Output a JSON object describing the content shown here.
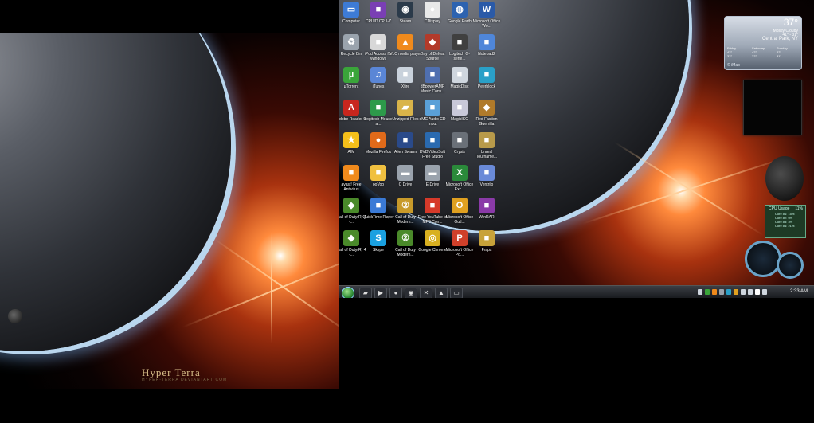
{
  "left_monitor": {
    "title": "Hyper Terra",
    "subtitle": "HYPER-TERRA DEVIANTART COM"
  },
  "desktop_icons": [
    {
      "label": "Computer",
      "icon": "computer-icon",
      "color": "#3d7bd6"
    },
    {
      "label": "CPUID CPU-Z",
      "icon": "cpuz-icon",
      "color": "#7a3fb4"
    },
    {
      "label": "Steam",
      "icon": "steam-icon",
      "color": "#2b3a4a"
    },
    {
      "label": "CDisplay",
      "icon": "speech-bubble-icon",
      "color": "#e9e9e9"
    },
    {
      "label": "Google Earth",
      "icon": "globe-icon",
      "color": "#2d63b0"
    },
    {
      "label": "Microsoft Office Wo...",
      "icon": "word-icon",
      "color": "#2a5aa8"
    },
    {
      "label": "Recycle Bin",
      "icon": "recycle-bin-icon",
      "color": "#9aa3ad"
    },
    {
      "label": "iPod Access for Windows",
      "icon": "ipod-icon",
      "color": "#d8d8d8"
    },
    {
      "label": "VLC media player",
      "icon": "vlc-icon",
      "color": "#f08a1c"
    },
    {
      "label": "Day of Defeat Source",
      "icon": "game-icon",
      "color": "#b33a2a"
    },
    {
      "label": "Logitech G-serie...",
      "icon": "logitech-icon",
      "color": "#404040"
    },
    {
      "label": "Notepad2",
      "icon": "notepad-icon",
      "color": "#4f86d9"
    },
    {
      "label": "µTorrent",
      "icon": "utorrent-icon",
      "color": "#3aa53a"
    },
    {
      "label": "iTunes",
      "icon": "itunes-icon",
      "color": "#5a86d6"
    },
    {
      "label": "Xfire",
      "icon": "xfire-icon",
      "color": "#c9d2dc"
    },
    {
      "label": "dBpowerAMP Music Conv...",
      "icon": "music-converter-icon",
      "color": "#4f6fb0"
    },
    {
      "label": "MagicDisc",
      "icon": "disc-icon",
      "color": "#cfd6de"
    },
    {
      "label": "Peerblock",
      "icon": "peerblock-icon",
      "color": "#2aa0c8"
    },
    {
      "label": "Adobe Reader 9",
      "icon": "adobe-reader-icon",
      "color": "#c8261e"
    },
    {
      "label": "Logitech Mouse a...",
      "icon": "mouse-icon",
      "color": "#2d9a4a"
    },
    {
      "label": "Unzipped Files",
      "icon": "folder-icon",
      "color": "#d9b44a"
    },
    {
      "label": "dMC Audio CD Input",
      "icon": "cd-icon",
      "color": "#5aa0d8"
    },
    {
      "label": "MagicISO",
      "icon": "magiciso-icon",
      "color": "#c8c8d8"
    },
    {
      "label": "Red Faction Guerrilla",
      "icon": "game-icon",
      "color": "#b07a2a"
    },
    {
      "label": "AIM",
      "icon": "aim-icon",
      "color": "#f5c01a"
    },
    {
      "label": "Mozilla Firefox",
      "icon": "firefox-icon",
      "color": "#e06a1a"
    },
    {
      "label": "Alien Swarm",
      "icon": "alien-swarm-icon",
      "color": "#2a4a8a"
    },
    {
      "label": "DVDVideoSoft Free Studio",
      "icon": "dvd-icon",
      "color": "#2a6ab0"
    },
    {
      "label": "Crysis",
      "icon": "crysis-icon",
      "color": "#6a7078"
    },
    {
      "label": "Unreal Tourname...",
      "icon": "unreal-icon",
      "color": "#b89a4a"
    },
    {
      "label": "avast! Free Antivirus",
      "icon": "avast-icon",
      "color": "#f08a1c"
    },
    {
      "label": "ooVoo",
      "icon": "oovoo-icon",
      "color": "#f0c040"
    },
    {
      "label": "C Drive",
      "icon": "drive-icon",
      "color": "#9aa3ad"
    },
    {
      "label": "E Drive",
      "icon": "drive-icon",
      "color": "#9aa3ad"
    },
    {
      "label": "Microsoft Office Exc...",
      "icon": "excel-icon",
      "color": "#2a8a3a"
    },
    {
      "label": "Ventrilo",
      "icon": "ventrilo-icon",
      "color": "#6a8ad8"
    },
    {
      "label": "Call of Duty(R) 4 -...",
      "icon": "game-icon",
      "color": "#4a8a2a"
    },
    {
      "label": "QuickTime Player",
      "icon": "quicktime-icon",
      "color": "#3a7ad6"
    },
    {
      "label": "Call of Duty Modern...",
      "icon": "cod-icon",
      "color": "#c89a2a"
    },
    {
      "label": "Free YouTube to MP3 Con...",
      "icon": "youtube-mp3-icon",
      "color": "#d63a2a"
    },
    {
      "label": "Microsoft Office Outl...",
      "icon": "outlook-icon",
      "color": "#e0a020"
    },
    {
      "label": "WinRAR",
      "icon": "winrar-icon",
      "color": "#8a3aa8"
    },
    {
      "label": "Call of Duty(R) 4 -...",
      "icon": "game-icon",
      "color": "#4a8a2a"
    },
    {
      "label": "Skype",
      "icon": "skype-icon",
      "color": "#1aa0e0"
    },
    {
      "label": "Call of Duty Modern...",
      "icon": "cod-icon",
      "color": "#4a8a2a"
    },
    {
      "label": "Google Chrome",
      "icon": "chrome-icon",
      "color": "#d8b020"
    },
    {
      "label": "Microsoft Office Po...",
      "icon": "powerpoint-icon",
      "color": "#d0402a"
    },
    {
      "label": "Fraps",
      "icon": "fraps-icon",
      "color": "#c8a23a"
    }
  ],
  "weather": {
    "temperature": "37°",
    "condition": "Mostly Cloudy",
    "range": "41° - 31°",
    "location": "Central Park, NY",
    "source": "© iMap",
    "forecast": [
      {
        "day": "Friday",
        "hi": "43°",
        "lo": "33°"
      },
      {
        "day": "Saturday",
        "hi": "42°",
        "lo": "32°"
      },
      {
        "day": "Sunday",
        "hi": "42°",
        "lo": "31°"
      }
    ]
  },
  "cpu_meter": {
    "title": "CPU Usage",
    "percent": "11%",
    "cores": [
      "Core #1: 15%",
      "Core #2: 6%",
      "Core #3: 4%",
      "Core #4: 21%"
    ]
  },
  "taskbar": {
    "buttons": [
      "folder-icon",
      "media-icon",
      "firefox-icon",
      "steam-icon",
      "xfire-icon",
      "vlc-icon",
      "monitor-icon"
    ],
    "tray_colors": [
      "#cfd6de",
      "#3aa53a",
      "#f08a1c",
      "#9aa3ad",
      "#2aa0c8",
      "#e0a020",
      "#cfd6de",
      "#cfd6de",
      "#ffffff",
      "#cfd6de"
    ],
    "clock": "2:33 AM"
  }
}
